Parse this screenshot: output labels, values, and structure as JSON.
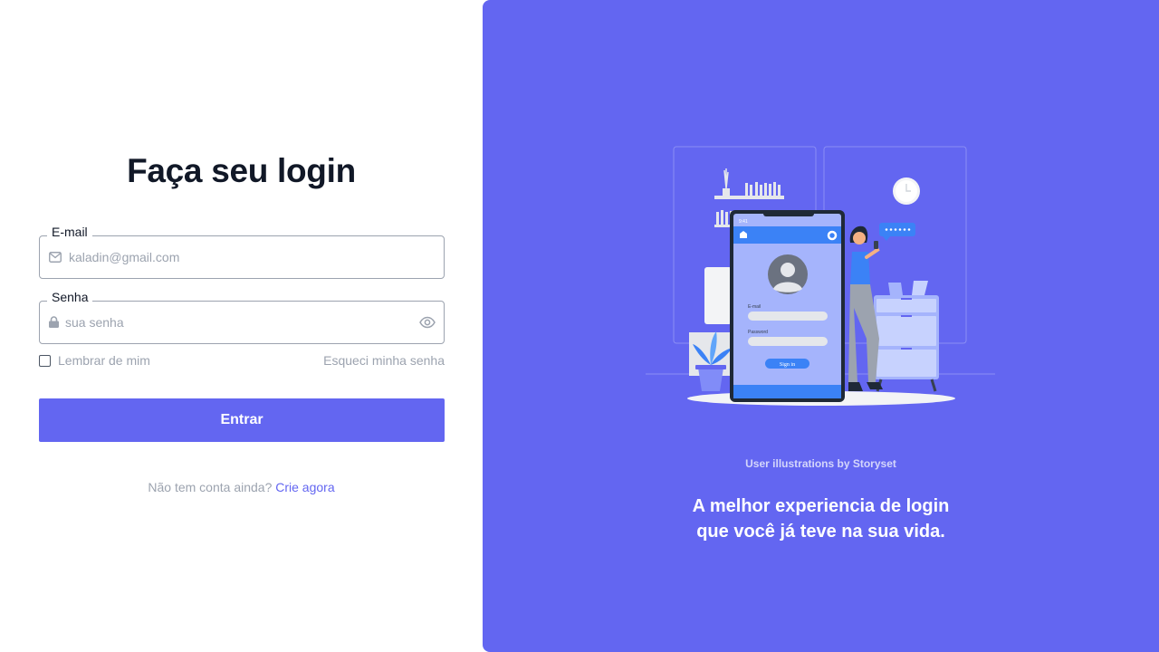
{
  "login": {
    "title": "Faça seu login",
    "email": {
      "label": "E-mail",
      "placeholder": "kaladin@gmail.com",
      "icon": "mail-icon"
    },
    "password": {
      "label": "Senha",
      "placeholder": "sua senha",
      "icon": "lock-icon",
      "toggle_icon": "eye-icon"
    },
    "remember_label": "Lembrar de mim",
    "remember_checked": false,
    "forgot_label": "Esqueci minha senha",
    "submit_label": "Entrar",
    "signup_prompt": "Não tem conta ainda?",
    "signup_link": "Crie agora"
  },
  "hero": {
    "credit": "User illustrations by Storyset",
    "tagline_line1": "A melhor experiencia de login",
    "tagline_line2": "que você já teve na sua vida.",
    "phone": {
      "email_label": "E-mail",
      "password_label": "Password",
      "button_label": "Sign in",
      "status_text": "9:41"
    }
  },
  "colors": {
    "accent": "#6366f1",
    "title": "#111827",
    "muted": "#9ca3af",
    "phone_blue": "#3b82f6"
  }
}
